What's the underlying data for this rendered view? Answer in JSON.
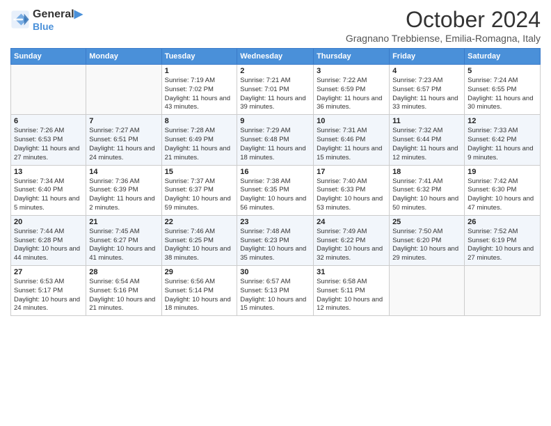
{
  "header": {
    "logo_line1": "General",
    "logo_line2": "Blue",
    "month": "October 2024",
    "location": "Gragnano Trebbiense, Emilia-Romagna, Italy"
  },
  "days_of_week": [
    "Sunday",
    "Monday",
    "Tuesday",
    "Wednesday",
    "Thursday",
    "Friday",
    "Saturday"
  ],
  "weeks": [
    [
      {
        "day": "",
        "info": ""
      },
      {
        "day": "",
        "info": ""
      },
      {
        "day": "1",
        "info": "Sunrise: 7:19 AM\nSunset: 7:02 PM\nDaylight: 11 hours and 43 minutes."
      },
      {
        "day": "2",
        "info": "Sunrise: 7:21 AM\nSunset: 7:01 PM\nDaylight: 11 hours and 39 minutes."
      },
      {
        "day": "3",
        "info": "Sunrise: 7:22 AM\nSunset: 6:59 PM\nDaylight: 11 hours and 36 minutes."
      },
      {
        "day": "4",
        "info": "Sunrise: 7:23 AM\nSunset: 6:57 PM\nDaylight: 11 hours and 33 minutes."
      },
      {
        "day": "5",
        "info": "Sunrise: 7:24 AM\nSunset: 6:55 PM\nDaylight: 11 hours and 30 minutes."
      }
    ],
    [
      {
        "day": "6",
        "info": "Sunrise: 7:26 AM\nSunset: 6:53 PM\nDaylight: 11 hours and 27 minutes."
      },
      {
        "day": "7",
        "info": "Sunrise: 7:27 AM\nSunset: 6:51 PM\nDaylight: 11 hours and 24 minutes."
      },
      {
        "day": "8",
        "info": "Sunrise: 7:28 AM\nSunset: 6:49 PM\nDaylight: 11 hours and 21 minutes."
      },
      {
        "day": "9",
        "info": "Sunrise: 7:29 AM\nSunset: 6:48 PM\nDaylight: 11 hours and 18 minutes."
      },
      {
        "day": "10",
        "info": "Sunrise: 7:31 AM\nSunset: 6:46 PM\nDaylight: 11 hours and 15 minutes."
      },
      {
        "day": "11",
        "info": "Sunrise: 7:32 AM\nSunset: 6:44 PM\nDaylight: 11 hours and 12 minutes."
      },
      {
        "day": "12",
        "info": "Sunrise: 7:33 AM\nSunset: 6:42 PM\nDaylight: 11 hours and 9 minutes."
      }
    ],
    [
      {
        "day": "13",
        "info": "Sunrise: 7:34 AM\nSunset: 6:40 PM\nDaylight: 11 hours and 5 minutes."
      },
      {
        "day": "14",
        "info": "Sunrise: 7:36 AM\nSunset: 6:39 PM\nDaylight: 11 hours and 2 minutes."
      },
      {
        "day": "15",
        "info": "Sunrise: 7:37 AM\nSunset: 6:37 PM\nDaylight: 10 hours and 59 minutes."
      },
      {
        "day": "16",
        "info": "Sunrise: 7:38 AM\nSunset: 6:35 PM\nDaylight: 10 hours and 56 minutes."
      },
      {
        "day": "17",
        "info": "Sunrise: 7:40 AM\nSunset: 6:33 PM\nDaylight: 10 hours and 53 minutes."
      },
      {
        "day": "18",
        "info": "Sunrise: 7:41 AM\nSunset: 6:32 PM\nDaylight: 10 hours and 50 minutes."
      },
      {
        "day": "19",
        "info": "Sunrise: 7:42 AM\nSunset: 6:30 PM\nDaylight: 10 hours and 47 minutes."
      }
    ],
    [
      {
        "day": "20",
        "info": "Sunrise: 7:44 AM\nSunset: 6:28 PM\nDaylight: 10 hours and 44 minutes."
      },
      {
        "day": "21",
        "info": "Sunrise: 7:45 AM\nSunset: 6:27 PM\nDaylight: 10 hours and 41 minutes."
      },
      {
        "day": "22",
        "info": "Sunrise: 7:46 AM\nSunset: 6:25 PM\nDaylight: 10 hours and 38 minutes."
      },
      {
        "day": "23",
        "info": "Sunrise: 7:48 AM\nSunset: 6:23 PM\nDaylight: 10 hours and 35 minutes."
      },
      {
        "day": "24",
        "info": "Sunrise: 7:49 AM\nSunset: 6:22 PM\nDaylight: 10 hours and 32 minutes."
      },
      {
        "day": "25",
        "info": "Sunrise: 7:50 AM\nSunset: 6:20 PM\nDaylight: 10 hours and 29 minutes."
      },
      {
        "day": "26",
        "info": "Sunrise: 7:52 AM\nSunset: 6:19 PM\nDaylight: 10 hours and 27 minutes."
      }
    ],
    [
      {
        "day": "27",
        "info": "Sunrise: 6:53 AM\nSunset: 5:17 PM\nDaylight: 10 hours and 24 minutes."
      },
      {
        "day": "28",
        "info": "Sunrise: 6:54 AM\nSunset: 5:16 PM\nDaylight: 10 hours and 21 minutes."
      },
      {
        "day": "29",
        "info": "Sunrise: 6:56 AM\nSunset: 5:14 PM\nDaylight: 10 hours and 18 minutes."
      },
      {
        "day": "30",
        "info": "Sunrise: 6:57 AM\nSunset: 5:13 PM\nDaylight: 10 hours and 15 minutes."
      },
      {
        "day": "31",
        "info": "Sunrise: 6:58 AM\nSunset: 5:11 PM\nDaylight: 10 hours and 12 minutes."
      },
      {
        "day": "",
        "info": ""
      },
      {
        "day": "",
        "info": ""
      }
    ]
  ]
}
